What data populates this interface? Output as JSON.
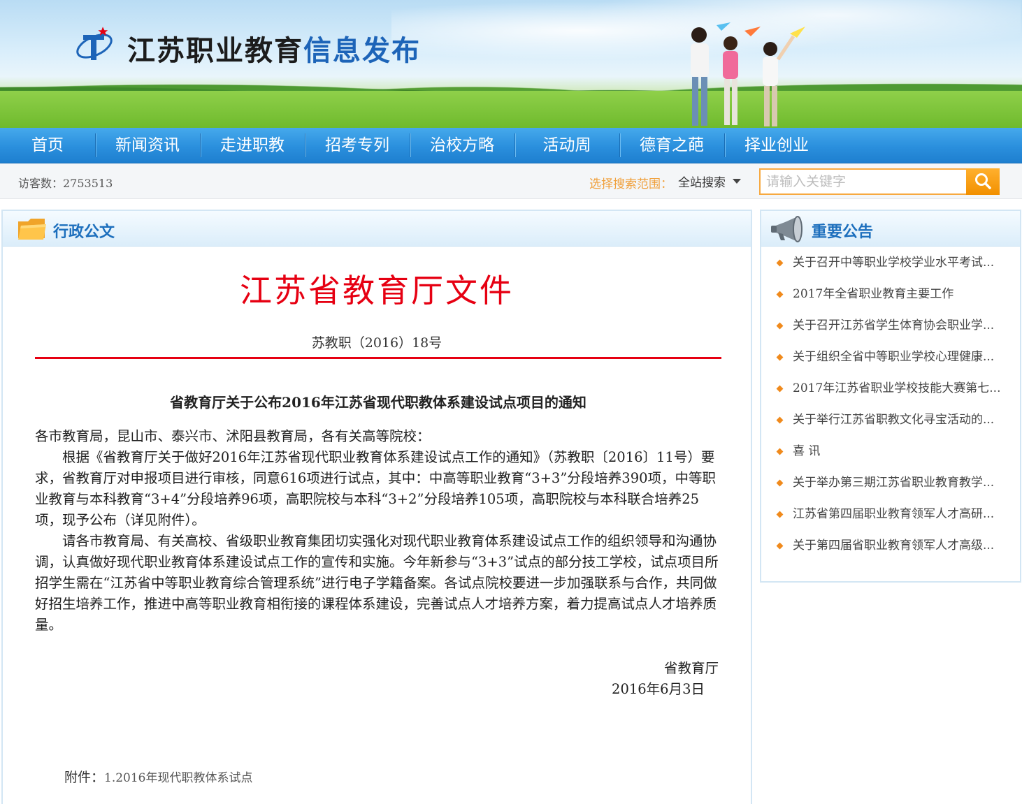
{
  "header": {
    "title_black": "江苏职业教育",
    "title_blue": "信息发布"
  },
  "nav": {
    "items": [
      {
        "label": "首页"
      },
      {
        "label": "新闻资讯"
      },
      {
        "label": "走进职教"
      },
      {
        "label": "招考专列"
      },
      {
        "label": "治校方略"
      },
      {
        "label": "活动周"
      },
      {
        "label": "德育之葩"
      },
      {
        "label": "择业创业"
      }
    ]
  },
  "infobar": {
    "visitor_label": "访客数：2753513",
    "scope_label": "选择搜索范围：",
    "scope_value": "全站搜索",
    "search_placeholder": "请输入关键字"
  },
  "main": {
    "panel_title": "行政公文",
    "doc_header": "江苏省教育厅文件",
    "doc_number": "苏教职（2016）18号",
    "subject": "省教育厅关于公布2016年江苏省现代职教体系建设试点项目的通知",
    "salutation": "各市教育局，昆山市、泰兴市、沭阳县教育局，各有关高等院校：",
    "para1": "根据《省教育厅关于做好2016年江苏省现代职业教育体系建设试点工作的通知》（苏教职〔2016〕11号）要求，省教育厅对申报项目进行审核，同意616项进行试点，其中：中高等职业教育“3+3”分段培养390项，中等职业教育与本科教育“3+4”分段培养96项，高职院校与本科“3+2”分段培养105项，高职院校与本科联合培养25项，现予公布（详见附件）。",
    "para2": "请各市教育局、有关高校、省级职业教育集团切实强化对现代职业教育体系建设试点工作的组织领导和沟通协调，认真做好现代职业教育体系建设试点工作的宣传和实施。今年新参与“3+3”试点的部分技工学校，试点项目所招学生需在“江苏省中等职业教育综合管理系统”进行电子学籍备案。各试点院校要进一步加强联系与合作，共同做好招生培养工作，推进中高等职业教育相衔接的课程体系建设，完善试点人才培养方案，着力提高试点人才培养质量。",
    "signature_org": "省教育厅",
    "signature_date": "2016年6月3日",
    "attachment_label": "附件：",
    "attachment_link": "1.2016年现代职教体系试点"
  },
  "sidebar": {
    "panel_title": "重要公告",
    "notices": [
      {
        "label": "关于召开中等职业学校学业水平考试..."
      },
      {
        "label": "2017年全省职业教育主要工作"
      },
      {
        "label": "关于召开江苏省学生体育协会职业学..."
      },
      {
        "label": "关于组织全省中等职业学校心理健康..."
      },
      {
        "label": "2017年江苏省职业学校技能大赛第七..."
      },
      {
        "label": "关于举行江苏省职教文化寻宝活动的..."
      },
      {
        "label": "喜 讯"
      },
      {
        "label": "关于举办第三期江苏省职业教育教学..."
      },
      {
        "label": "江苏省第四届职业教育领军人才高研..."
      },
      {
        "label": "关于第四届省职业教育领军人才高级..."
      }
    ]
  },
  "colors": {
    "nav_blue": "#2a8fdd",
    "doc_red": "#e60012",
    "title_blue": "#1d6fbd",
    "accent_orange": "#f29000"
  },
  "icons": [
    "logo-icon",
    "folder-icon",
    "megaphone-icon",
    "search-icon",
    "dropdown-arrow-icon"
  ]
}
